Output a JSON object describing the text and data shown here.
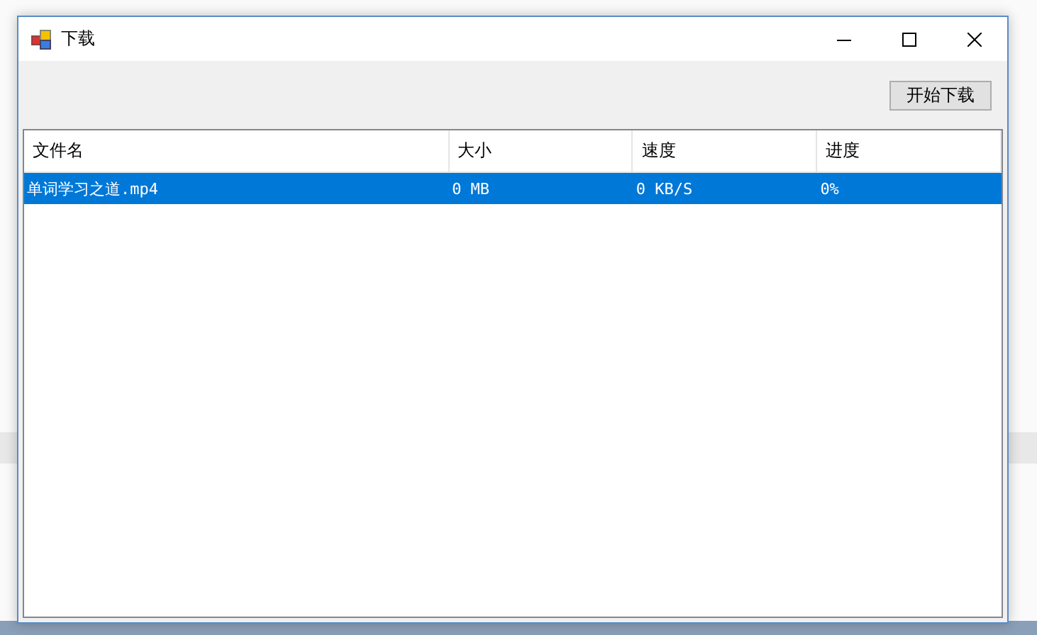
{
  "window": {
    "title": "下载"
  },
  "toolbar": {
    "buttons": [
      "开始下载"
    ]
  },
  "list": {
    "columns": [
      "文件名",
      "大小",
      "速度",
      "进度"
    ],
    "rows": [
      {
        "cells": [
          "单词学习之道.mp4",
          "0 MB",
          "0 KB/S",
          "0%"
        ],
        "selected": true
      }
    ]
  }
}
